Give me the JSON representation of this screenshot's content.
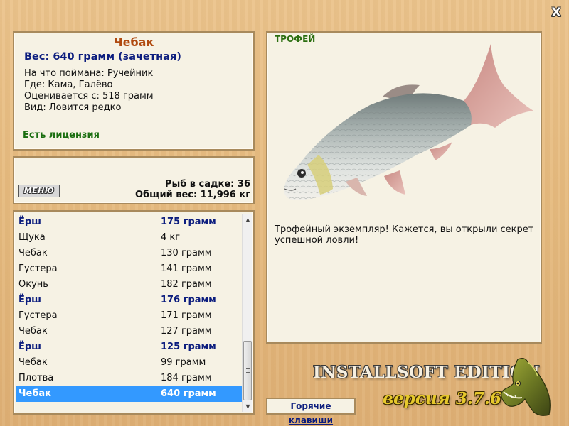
{
  "window": {
    "close_glyph": "X"
  },
  "info": {
    "name": "Чебак",
    "weight": "Вес: 640 грамм (зачетная)",
    "caught_on": "На что поймана: Ручейник",
    "location": "Где: Кама, Галёво",
    "rated_from": "Оценивается с: 518 грамм",
    "kind": "Вид: Ловится редко",
    "license": "Есть лицензия"
  },
  "cage": {
    "menu_label": "МЕНЮ",
    "fish_count": "Рыб в садке: 36",
    "total_weight": "Общий вес: 11,996 кг"
  },
  "catch_list": [
    {
      "name": "Ёрш",
      "weight": "175 грамм"
    },
    {
      "name": "Щука",
      "weight": "4 кг"
    },
    {
      "name": "Чебак",
      "weight": "130 грамм"
    },
    {
      "name": "Густера",
      "weight": "141 грамм"
    },
    {
      "name": "Окунь",
      "weight": "182 грамм"
    },
    {
      "name": "Ёрш",
      "weight": "176 грамм"
    },
    {
      "name": "Густера",
      "weight": "171 грамм"
    },
    {
      "name": "Чебак",
      "weight": "127 грамм"
    },
    {
      "name": "Ёрш",
      "weight": "125 грамм"
    },
    {
      "name": "Чебак",
      "weight": "99 грамм"
    },
    {
      "name": "Плотва",
      "weight": "184 грамм"
    },
    {
      "name": "Чебак",
      "weight": "640 грамм"
    }
  ],
  "trophy": {
    "label": "ТРОФЕЙ",
    "message": "Трофейный экземпляр! Кажется, вы открыли секрет успешной ловли!",
    "image_icon": "fish-icon"
  },
  "footer": {
    "hotkeys_label": "Горячие клавиши",
    "edition": "INSTALLSOFT EDITION",
    "version": "версия 3.7.6",
    "logo_icon": "pike-icon"
  },
  "colors": {
    "fish_name": "#b04a10",
    "weight_blue": "#0c1d7e",
    "license_green": "#1a6e10",
    "selection": "#3399ff",
    "panel_bg": "#f6f2e4",
    "panel_border": "#a88a5c",
    "wood": "#e6bb80"
  }
}
